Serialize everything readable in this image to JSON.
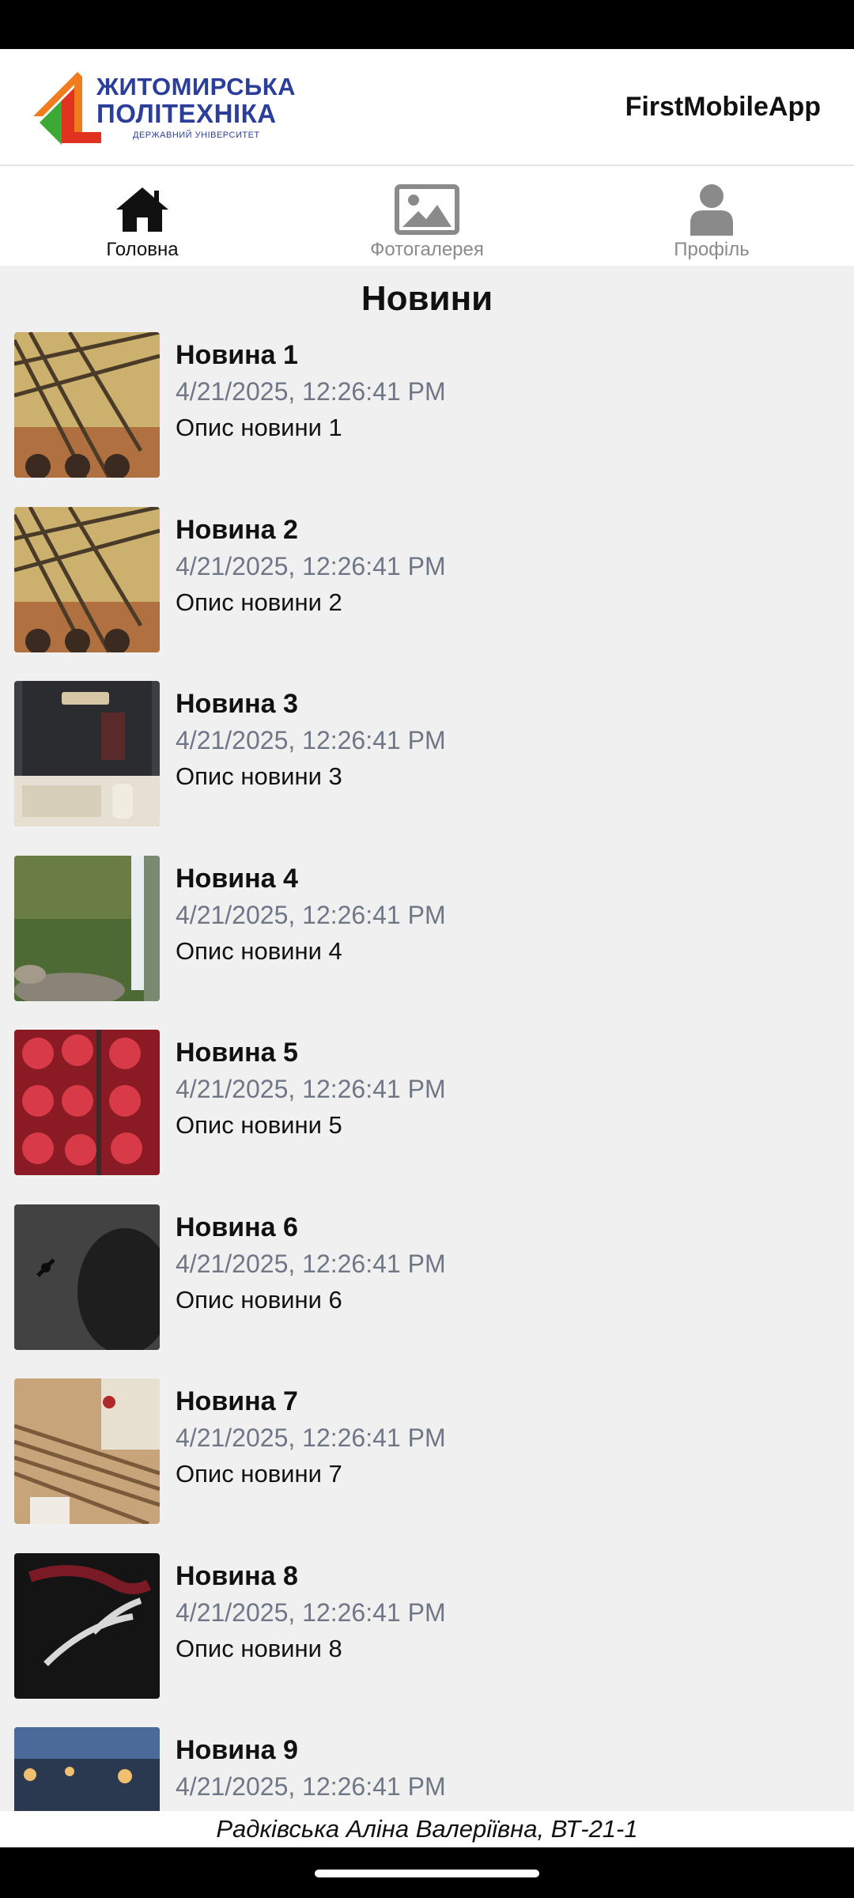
{
  "header": {
    "logo_line1": "ЖИТОМИРСЬКА",
    "logo_line2": "ПОЛІТЕХНІКА",
    "logo_line3": "ДЕРЖАВНИЙ УНІВЕРСИТЕТ",
    "app_name": "FirstMobileApp"
  },
  "tabs": [
    {
      "label": "Головна",
      "icon": "home-icon",
      "active": true
    },
    {
      "label": "Фотогалерея",
      "icon": "image-icon",
      "active": false
    },
    {
      "label": "Профіль",
      "icon": "person-icon",
      "active": false
    }
  ],
  "page": {
    "title": "Новини"
  },
  "news": [
    {
      "title": "Новина 1",
      "date": "4/21/2025, 12:26:41 PM",
      "desc": "Опис новини 1"
    },
    {
      "title": "Новина 2",
      "date": "4/21/2025, 12:26:41 PM",
      "desc": "Опис новини 2"
    },
    {
      "title": "Новина 3",
      "date": "4/21/2025, 12:26:41 PM",
      "desc": "Опис новини 3"
    },
    {
      "title": "Новина 4",
      "date": "4/21/2025, 12:26:41 PM",
      "desc": "Опис новини 4"
    },
    {
      "title": "Новина 5",
      "date": "4/21/2025, 12:26:41 PM",
      "desc": "Опис новини 5"
    },
    {
      "title": "Новина 6",
      "date": "4/21/2025, 12:26:41 PM",
      "desc": "Опис новини 6"
    },
    {
      "title": "Новина 7",
      "date": "4/21/2025, 12:26:41 PM",
      "desc": "Опис новини 7"
    },
    {
      "title": "Новина 8",
      "date": "4/21/2025, 12:26:41 PM",
      "desc": "Опис новини 8"
    },
    {
      "title": "Новина 9",
      "date": "4/21/2025, 12:26:41 PM",
      "desc": ""
    }
  ],
  "footer": {
    "text": "Радківська Аліна Валеріївна, ВТ-21-1"
  },
  "colors": {
    "brand_blue": "#2b3e9b",
    "brand_orange": "#f07c1e",
    "brand_green": "#3aa935",
    "brand_red": "#e0321e"
  }
}
